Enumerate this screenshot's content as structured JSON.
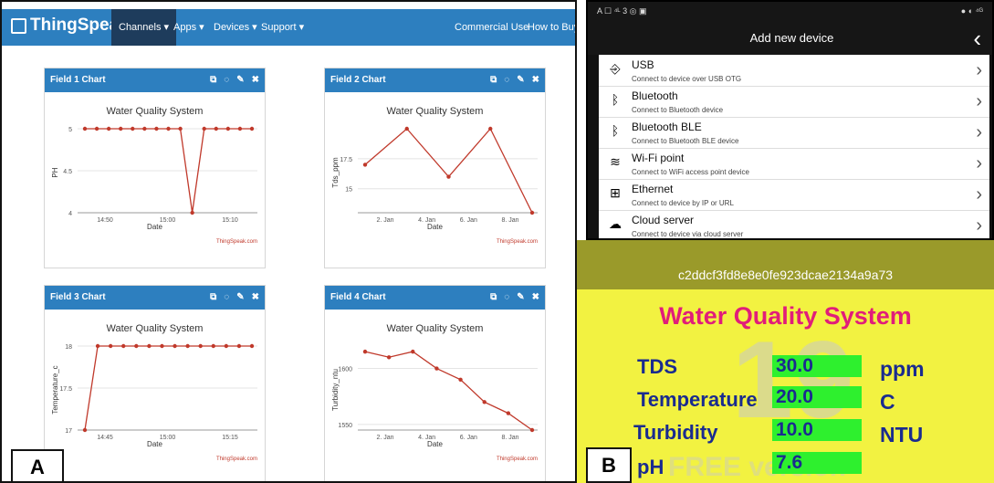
{
  "panelA": {
    "label": "A",
    "nav": {
      "brand": "ThingSpeak",
      "trademark": "™",
      "items": [
        "Channels",
        "Apps",
        "Devices",
        "Support"
      ],
      "right_items": [
        "Commercial Use",
        "How to Buy"
      ]
    },
    "icons": [
      "external-link-icon",
      "comment-icon",
      "pencil-icon",
      "close-icon"
    ],
    "charts": [
      {
        "header": "Field 1 Chart",
        "title": "Water Quality System",
        "ylabel": "PH",
        "xlabel": "Date",
        "credit": "ThingSpeak.com",
        "yticks": [
          "5",
          "4.5",
          "4"
        ],
        "xticks": [
          "14:50",
          "15:00",
          "15:10"
        ],
        "chart_data": {
          "type": "line",
          "title": "Water Quality System",
          "xlabel": "Date",
          "ylabel": "PH",
          "ylim": [
            4,
            5
          ],
          "series": [
            {
              "values": [
                5,
                5,
                5,
                5,
                5,
                5,
                5,
                5,
                5,
                4,
                5,
                5,
                5,
                5,
                5
              ]
            }
          ]
        }
      },
      {
        "header": "Field 2 Chart",
        "title": "Water Quality System",
        "ylabel": "Tds_ppm",
        "xlabel": "Date",
        "credit": "ThingSpeak.com",
        "yticks": [
          "17.5",
          "15"
        ],
        "xticks": [
          "2. Jan",
          "4. Jan",
          "6. Jan",
          "8. Jan"
        ],
        "chart_data": {
          "type": "line",
          "title": "Water Quality System",
          "xlabel": "Date",
          "ylabel": "Tds_ppm",
          "ylim": [
            13,
            20
          ],
          "series": [
            {
              "values": [
                17,
                20,
                16,
                20,
                13
              ]
            }
          ]
        }
      },
      {
        "header": "Field 3 Chart",
        "title": "Water Quality System",
        "ylabel": "Temperature_c",
        "xlabel": "Date",
        "credit": "ThingSpeak.com",
        "yticks": [
          "18",
          "17.5",
          "17"
        ],
        "xticks": [
          "14:45",
          "15:00",
          "15:15"
        ],
        "chart_data": {
          "type": "line",
          "title": "Water Quality System",
          "xlabel": "Date",
          "ylabel": "Temperature_c",
          "ylim": [
            17,
            18
          ],
          "series": [
            {
              "values": [
                17,
                18,
                18,
                18,
                18,
                18,
                18,
                18,
                18,
                18,
                18,
                18,
                18,
                18
              ]
            }
          ]
        }
      },
      {
        "header": "Field 4 Chart",
        "title": "Water Quality System",
        "ylabel": "Turbidity_ntu",
        "xlabel": "Date",
        "credit": "ThingSpeak.com",
        "yticks": [
          "1600",
          "1550"
        ],
        "xticks": [
          "2. Jan",
          "4. Jan",
          "6. Jan",
          "8. Jan"
        ],
        "chart_data": {
          "type": "line",
          "title": "Water Quality System",
          "xlabel": "Date",
          "ylabel": "Turbidity_ntu",
          "ylim": [
            1545,
            1620
          ],
          "series": [
            {
              "values": [
                1615,
                1610,
                1615,
                1600,
                1590,
                1570,
                1560,
                1545
              ]
            }
          ]
        }
      }
    ]
  },
  "phone": {
    "status_left": "A ☐ ⁴ᴸ 3 ◎ ▣",
    "status_right": "● ◐ ⁴ᴳ",
    "title": "Add new device",
    "back": "‹",
    "items": [
      {
        "title": "USB",
        "subtitle": "Connect to device over USB OTG",
        "icon": "usb-icon",
        "glyph": "⎆"
      },
      {
        "title": "Bluetooth",
        "subtitle": "Connect to Bluetooth device",
        "icon": "bluetooth-icon",
        "glyph": "ᛒ"
      },
      {
        "title": "Bluetooth BLE",
        "subtitle": "Connect to Bluetooth BLE device",
        "icon": "bluetooth-icon",
        "glyph": "ᛒ"
      },
      {
        "title": "Wi-Fi point",
        "subtitle": "Connect to WiFi access point device",
        "icon": "wifi-icon",
        "glyph": "≋"
      },
      {
        "title": "Ethernet",
        "subtitle": "Connect to device by IP or URL",
        "icon": "network-icon",
        "glyph": "⊞"
      },
      {
        "title": "Cloud server",
        "subtitle": "Connect to device via cloud server",
        "icon": "cloud-icon",
        "glyph": "☁"
      }
    ]
  },
  "greenscreen": {
    "label": "B",
    "device_id": "c2ddcf3fd8e8e0fe923dcae2134a9a73",
    "title": "Water Quality System",
    "rows": [
      {
        "name": "TDS",
        "value": "30.0",
        "unit": "ppm"
      },
      {
        "name": "Temperature",
        "value": "20.0",
        "unit": "C"
      },
      {
        "name": "Turbidity",
        "value": "10.0",
        "unit": "NTU"
      },
      {
        "name": "pH",
        "value": "7.6",
        "unit": ""
      }
    ],
    "watermark": "19",
    "watermark2": "FREE version"
  },
  "colors": {
    "thingspeak_blue": "#2d7fbf",
    "nav_active": "#1e3c5c",
    "series_red": "#c0392b",
    "gs_yellow": "#f2f241",
    "gs_title_bar": "#9a9a2a",
    "gs_pink": "#e11d7a",
    "gs_blue": "#1a2b8f",
    "gs_green": "#2ef02e"
  }
}
